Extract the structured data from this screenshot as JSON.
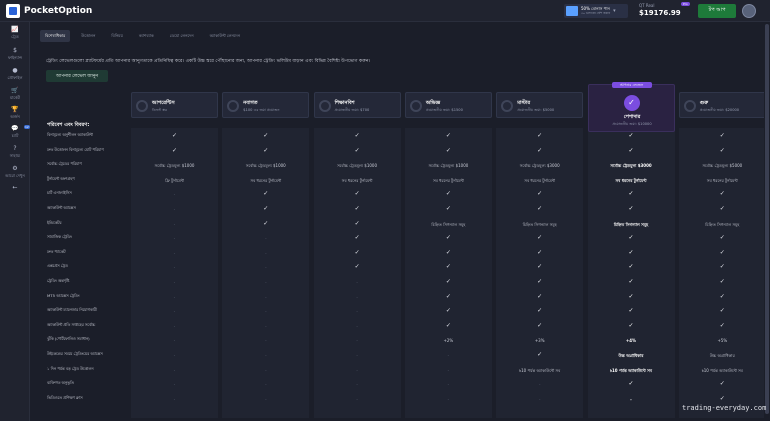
{
  "app": {
    "name": "PocketOption"
  },
  "header": {
    "bonus_title": "50% বোনাস পান",
    "bonus_sub": "৫০ ডলারের বেশি জমায়",
    "account_type": "QT Real",
    "balance": "$19176.99",
    "balance_badge": "Pro",
    "topup_label": "টপ আপ"
  },
  "sidebar": {
    "items": [
      {
        "icon": "📈",
        "label": "ট্রেড"
      },
      {
        "icon": "$",
        "label": "ফাইন্যান্স"
      },
      {
        "icon": "●",
        "label": "প্রোফাইল"
      },
      {
        "icon": "🛒",
        "label": "মার্কেট"
      },
      {
        "icon": "🏆",
        "label": "অর্জন"
      },
      {
        "icon": "💬",
        "label": "চ্যাট",
        "badge": "12"
      },
      {
        "icon": "?",
        "label": "সাহায্য"
      },
      {
        "icon": "⚙",
        "label": "আরো দেখুন"
      },
      {
        "icon": "←",
        "label": ""
      }
    ]
  },
  "tabs": [
    {
      "label": "বিশেষাধিকার",
      "active": true
    },
    {
      "label": "উত্তোলন"
    },
    {
      "label": "বিনিময়"
    },
    {
      "label": "ক্যাশব্যাক"
    },
    {
      "label": "ডেমো লেনদেন"
    },
    {
      "label": "অ্যাকাউন্ট লেনদেন"
    }
  ],
  "intro_text": "ট্রেডিং লেভেলগুলো প্ল্যাটফর্মের প্রতি আপনার আনুগত্যকে প্রতিনিধিত্ব করে। একটি উচ্চ স্তরে পৌঁছানোর জন্য, আপনার ট্রেডিং ভলিউম বাড়ান এবং বিভিন্ন বৈশিষ্ট্য উপভোগ করুন।",
  "know_button": "আপনার লেভেল জানুন",
  "table": {
    "header_label": "পরিবেশ এবং বিবরণ:",
    "levels": [
      {
        "name": "আপরেন্টিস",
        "sub": "ডিফল্ট স্তর"
      },
      {
        "name": "নবাগত",
        "sub": "$100 এর জমা প্রয়োজন"
      },
      {
        "name": "শিক্ষানবিশ",
        "sub": "প্রয়োজনীয় জমা: $700"
      },
      {
        "name": "অভিজ্ঞ",
        "sub": "প্রয়োজনীয় জমা: $1500"
      },
      {
        "name": "মাস্টার",
        "sub": "প্রয়োজনীয় জমা: $5000"
      },
      {
        "name": "পেশাদার",
        "sub": "প্রয়োজনীয় জমা: $10000",
        "badge": "আপনার লেভেল",
        "current": true
      },
      {
        "name": "গুরু",
        "sub": "প্রয়োজনীয় জমা: $20000"
      }
    ],
    "rows": [
      {
        "label": "বিনামূল্যে অনুশীলন অ্যাকাউন্ট",
        "cells": [
          "✓",
          "✓",
          "✓",
          "✓",
          "✓",
          "✓",
          "✓"
        ]
      },
      {
        "label": "দ্রুত উত্তোলন বিনামূল্যে মোট পরিমাণ",
        "cells": [
          "✓",
          "✓",
          "✓",
          "✓",
          "✓",
          "✓",
          "✓"
        ]
      },
      {
        "label": "সর্বোচ্চ ট্রেডের পরিমাণ",
        "cells": [
          "সর্বোচ্চ ট্রেডমূল্য $1000",
          "সর্বোচ্চ ট্রেডমূল্য $1000",
          "সর্বোচ্চ ট্রেডমূল্য $1000",
          "সর্বোচ্চ ট্রেডমূল্য $1000",
          "সর্বোচ্চ ট্রেডমূল্য $3000",
          "সর্বোচ্চ ট্রেডমূল্য $3000",
          "সর্বোচ্চ ট্রেডমূল্য $5000"
        ]
      },
      {
        "label": "টুর্নামেন্ট অংশগ্রহণ",
        "cells": [
          "ফ্রি টুর্নামেন্ট",
          "সব ধরনের টুর্নামেন্ট",
          "সব ধরনের টুর্নামেন্ট",
          "সব ধরনের টুর্নামেন্ট",
          "সব ধরনের টুর্নামেন্ট",
          "সব ধরনের টুর্নামেন্ট",
          "সব ধরনের টুর্নামেন্ট"
        ]
      },
      {
        "label": "চার্ট এনালাইসিস",
        "cells": [
          "-",
          "✓",
          "✓",
          "✓",
          "✓",
          "✓",
          "✓"
        ]
      },
      {
        "label": "অ্যাকাউন্ট অ্যাক্সেস",
        "cells": [
          "-",
          "✓",
          "✓",
          "✓",
          "✓",
          "✓",
          "✓"
        ]
      },
      {
        "label": "ইন্ডিকেটর",
        "cells": [
          "-",
          "✓",
          "✓",
          "চিহ্নিত সিগন্যাল সমূহ",
          "চিহ্নিত সিগন্যাল সমূহ",
          "চিহ্নিত সিগন্যাল সমূহ",
          "চিহ্নিত সিগন্যাল সমূহ"
        ]
      },
      {
        "label": "সামাজিক ট্রেডিং",
        "cells": [
          "-",
          "-",
          "✓",
          "✓",
          "✓",
          "✓",
          "✓"
        ]
      },
      {
        "label": "দ্রুত প্যাকেট",
        "cells": [
          "-",
          "-",
          "✓",
          "✓",
          "✓",
          "✓",
          "✓"
        ]
      },
      {
        "label": "এক্সপ্রেস ট্রেড",
        "cells": [
          "-",
          "-",
          "✓",
          "✓",
          "✓",
          "✓",
          "✓"
        ]
      },
      {
        "label": "ট্রেডিং অন্তর্দৃষ্টি",
        "cells": [
          "-",
          "-",
          "-",
          "✓",
          "✓",
          "✓",
          "✓"
        ]
      },
      {
        "label": "MT5 অ্যাক্সেস ট্রেডিং",
        "cells": [
          "-",
          "-",
          "-",
          "✓",
          "✓",
          "✓",
          "✓"
        ]
      },
      {
        "label": "অ্যাকাউন্ট ম্যানেজার নিয়োগকারী",
        "cells": [
          "-",
          "-",
          "-",
          "✓",
          "✓",
          "✓",
          "✓"
        ]
      },
      {
        "label": "অ্যাকাউন্ট প্রতি সপ্তাহের সর্বোচ্চ",
        "cells": [
          "-",
          "-",
          "-",
          "✓",
          "✓",
          "✓",
          "✓"
        ]
      },
      {
        "label": "ঝুঁকি (পোর্টফোলিও সমাধান)",
        "cells": [
          "-",
          "-",
          "-",
          "+2%",
          "+3%",
          "+4%",
          "+5%"
        ]
      },
      {
        "label": "উইকেন্ডের সময়ে ট্রেডিংয়ের অ্যাক্সেস",
        "cells": [
          "-",
          "-",
          "-",
          "-",
          "✓",
          "উচ্চ অগ্রাধিকার",
          "উচ্চ অগ্রাধিকার"
        ]
      },
      {
        "label": "১ দিন পর্যন্ত বড় ট্রেড উত্তোলন",
        "cells": [
          "-",
          "-",
          "-",
          "-",
          "৳10 পর্যন্ত অ্যাকাউন্টে সব",
          "৳10 পর্যন্ত অ্যাকাউন্টে সব",
          "৳10 পর্যন্ত অ্যাকাউন্টে সব"
        ]
      },
      {
        "label": "ব্যক্তিগত অনুভূতি",
        "cells": [
          "-",
          "-",
          "-",
          "-",
          "-",
          "✓",
          "✓"
        ]
      },
      {
        "label": "ভিডিওতে প্রশিক্ষণ ক্লাস",
        "cells": [
          "-",
          "-",
          "-",
          "-",
          "-",
          "-",
          "✓"
        ]
      }
    ]
  },
  "watermark": "trading-everyday.com"
}
